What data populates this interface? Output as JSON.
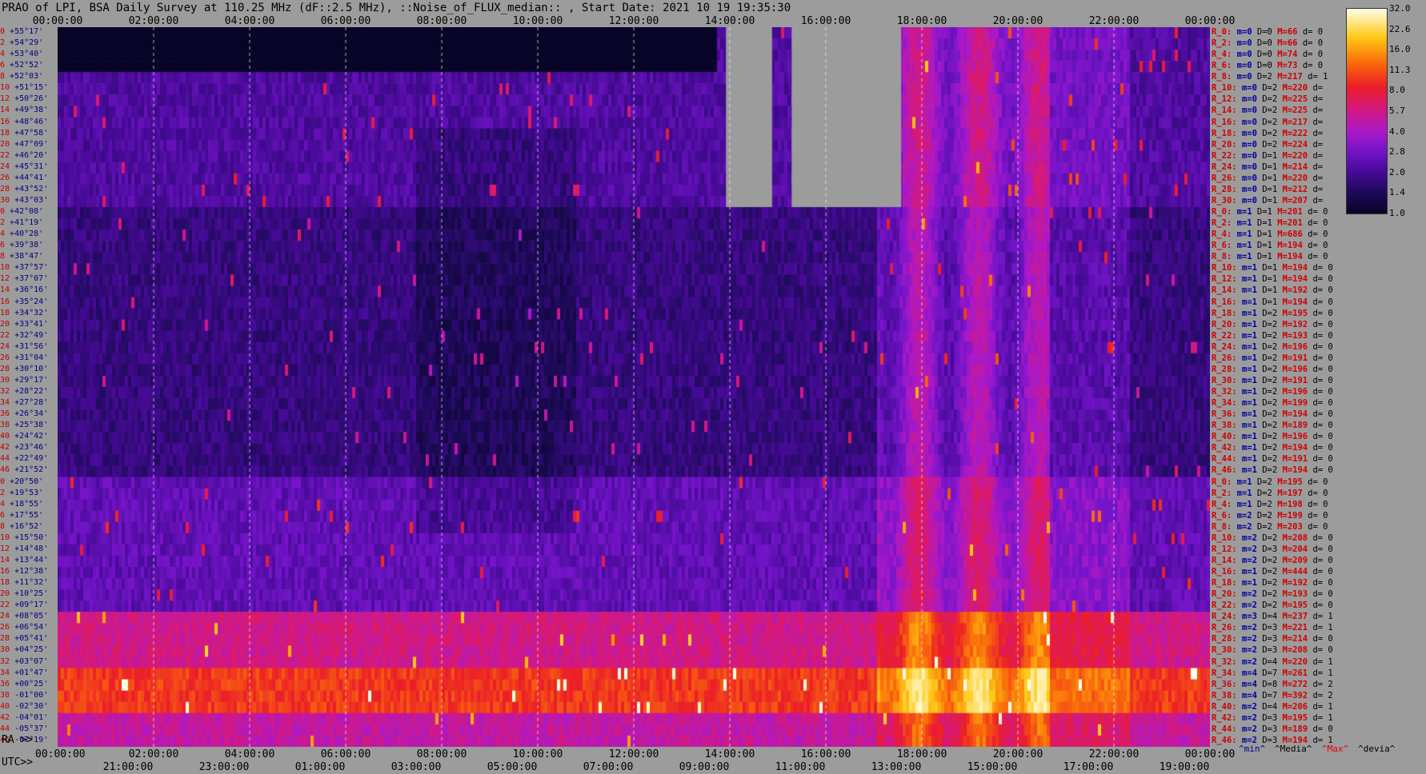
{
  "title": "PRAO of LPI, BSA Daily Survey at 110.25 MHz (dF::2.5 MHz), ::Noise_of_FLUX_median:: , Start Date: 2021 10 19 19:35:30",
  "chart_data": {
    "type": "heatmap",
    "top_axis_ticks": [
      "00:00:00",
      "02:00:00",
      "04:00:00",
      "06:00:00",
      "08:00:00",
      "10:00:00",
      "12:00:00",
      "14:00:00",
      "16:00:00",
      "18:00:00",
      "20:00:00",
      "22:00:00",
      "00:00:00"
    ],
    "ra_label": "RA >>",
    "ra_ticks": [
      "00:00:00",
      "02:00:00",
      "04:00:00",
      "06:00:00",
      "08:00:00",
      "10:00:00",
      "12:00:00",
      "14:00:00",
      "16:00:00",
      "18:00:00",
      "20:00:00",
      "22:00:00",
      "00:00:00"
    ],
    "utc_label": "UTC>>",
    "utc_ticks": [
      "21:00:00",
      "23:00:00",
      "01:00:00",
      "03:00:00",
      "05:00:00",
      "07:00:00",
      "09:00:00",
      "11:00:00",
      "13:00:00",
      "15:00:00",
      "17:00:00",
      "19:00:00"
    ],
    "colorbar_ticks": [
      "32.0",
      "22.6",
      "16.0",
      "11.3",
      "8.0",
      "5.7",
      "4.0",
      "2.8",
      "2.0",
      "1.4",
      "1.0"
    ],
    "colorbar_range": [
      1.0,
      32.0
    ],
    "colorbar_scale": "log",
    "row_indices": [
      "0",
      "2",
      "4",
      "6",
      "8",
      "10",
      "12",
      "14",
      "16",
      "18",
      "20",
      "22",
      "24",
      "26",
      "28",
      "30",
      "0",
      "2",
      "4",
      "6",
      "8",
      "10",
      "12",
      "14",
      "16",
      "18",
      "20",
      "22",
      "24",
      "26",
      "28",
      "30",
      "32",
      "34",
      "36",
      "38",
      "40",
      "42",
      "44",
      "46",
      "0",
      "2",
      "4",
      "6",
      "8",
      "10",
      "12",
      "14",
      "16",
      "18",
      "20",
      "22",
      "24",
      "26",
      "28",
      "30",
      "32",
      "34",
      "36",
      "38",
      "40",
      "42",
      "44",
      "46"
    ],
    "declinations": [
      "+55°17'",
      "+54°29'",
      "+53°40'",
      "+52°52'",
      "+52°03'",
      "+51°15'",
      "+50°26'",
      "+49°38'",
      "+48°46'",
      "+47°58'",
      "+47°09'",
      "+46°20'",
      "+45°31'",
      "+44°41'",
      "+43°52'",
      "+43°03'",
      "+42°08'",
      "+41°19'",
      "+40°28'",
      "+39°38'",
      "+38°47'",
      "+37°57'",
      "+37°07'",
      "+36°16'",
      "+35°24'",
      "+34°32'",
      "+33°41'",
      "+32°49'",
      "+31°56'",
      "+31°04'",
      "+30°10'",
      "+29°17'",
      "+28°22'",
      "+27°28'",
      "+26°34'",
      "+25°38'",
      "+24°42'",
      "+23°46'",
      "+22°49'",
      "+21°52'",
      "+20°50'",
      "+19°53'",
      "+18°55'",
      "+17°55'",
      "+16°52'",
      "+15°50'",
      "+14°48'",
      "+13°44'",
      "+12°38'",
      "+11°32'",
      "+10°25'",
      "+09°17'",
      "+08°05'",
      "+06°54'",
      "+05°41'",
      "+04°25'",
      "+03°07'",
      "+01°47'",
      "+00°25'",
      "-01°00'",
      "-02°30'",
      "-04°01'",
      "-05°37'",
      "-07°19'"
    ],
    "row_stats": [
      {
        "r": "R_0:",
        "m": "m=0",
        "D": "D=0",
        "M": "M=66",
        "d": "d= 0"
      },
      {
        "r": "R_2:",
        "m": "m=0",
        "D": "D=0",
        "M": "M=66",
        "d": "d= 0"
      },
      {
        "r": "R_4:",
        "m": "m=0",
        "D": "D=0",
        "M": "M=74",
        "d": "d= 0"
      },
      {
        "r": "R_6:",
        "m": "m=0",
        "D": "D=0",
        "M": "M=73",
        "d": "d= 0"
      },
      {
        "r": "R_8:",
        "m": "m=0",
        "D": "D=2",
        "M": "M=217",
        "d": "d= 1"
      },
      {
        "r": "R_10:",
        "m": "m=0",
        "D": "D=2",
        "M": "M=220",
        "d": "d="
      },
      {
        "r": "R_12:",
        "m": "m=0",
        "D": "D=2",
        "M": "M=225",
        "d": "d="
      },
      {
        "r": "R_14:",
        "m": "m=0",
        "D": "D=2",
        "M": "M=225",
        "d": "d="
      },
      {
        "r": "R_16:",
        "m": "m=0",
        "D": "D=2",
        "M": "M=217",
        "d": "d="
      },
      {
        "r": "R_18:",
        "m": "m=0",
        "D": "D=2",
        "M": "M=222",
        "d": "d="
      },
      {
        "r": "R_20:",
        "m": "m=0",
        "D": "D=2",
        "M": "M=224",
        "d": "d="
      },
      {
        "r": "R_22:",
        "m": "m=0",
        "D": "D=1",
        "M": "M=220",
        "d": "d="
      },
      {
        "r": "R_24:",
        "m": "m=0",
        "D": "D=1",
        "M": "M=214",
        "d": "d="
      },
      {
        "r": "R_26:",
        "m": "m=0",
        "D": "D=1",
        "M": "M=220",
        "d": "d="
      },
      {
        "r": "R_28:",
        "m": "m=0",
        "D": "D=1",
        "M": "M=212",
        "d": "d="
      },
      {
        "r": "R_30:",
        "m": "m=0",
        "D": "D=1",
        "M": "M=207",
        "d": "d="
      },
      {
        "r": "R_0:",
        "m": "m=1",
        "D": "D=1",
        "M": "M=201",
        "d": "d= 0"
      },
      {
        "r": "R_2:",
        "m": "m=1",
        "D": "D=1",
        "M": "M=201",
        "d": "d= 0"
      },
      {
        "r": "R_4:",
        "m": "m=1",
        "D": "D=1",
        "M": "M=686",
        "d": "d= 0"
      },
      {
        "r": "R_6:",
        "m": "m=1",
        "D": "D=1",
        "M": "M=194",
        "d": "d= 0"
      },
      {
        "r": "R_8:",
        "m": "m=1",
        "D": "D=1",
        "M": "M=194",
        "d": "d= 0"
      },
      {
        "r": "R_10:",
        "m": "m=1",
        "D": "D=1",
        "M": "M=194",
        "d": "d= 0"
      },
      {
        "r": "R_12:",
        "m": "m=1",
        "D": "D=1",
        "M": "M=194",
        "d": "d= 0"
      },
      {
        "r": "R_14:",
        "m": "m=1",
        "D": "D=1",
        "M": "M=192",
        "d": "d= 0"
      },
      {
        "r": "R_16:",
        "m": "m=1",
        "D": "D=1",
        "M": "M=194",
        "d": "d= 0"
      },
      {
        "r": "R_18:",
        "m": "m=1",
        "D": "D=2",
        "M": "M=195",
        "d": "d= 0"
      },
      {
        "r": "R_20:",
        "m": "m=1",
        "D": "D=2",
        "M": "M=192",
        "d": "d= 0"
      },
      {
        "r": "R_22:",
        "m": "m=1",
        "D": "D=2",
        "M": "M=193",
        "d": "d= 0"
      },
      {
        "r": "R_24:",
        "m": "m=1",
        "D": "D=2",
        "M": "M=196",
        "d": "d= 0"
      },
      {
        "r": "R_26:",
        "m": "m=1",
        "D": "D=2",
        "M": "M=191",
        "d": "d= 0"
      },
      {
        "r": "R_28:",
        "m": "m=1",
        "D": "D=2",
        "M": "M=196",
        "d": "d= 0"
      },
      {
        "r": "R_30:",
        "m": "m=1",
        "D": "D=2",
        "M": "M=191",
        "d": "d= 0"
      },
      {
        "r": "R_32:",
        "m": "m=1",
        "D": "D=2",
        "M": "M=196",
        "d": "d= 0"
      },
      {
        "r": "R_34:",
        "m": "m=1",
        "D": "D=2",
        "M": "M=199",
        "d": "d= 0"
      },
      {
        "r": "R_36:",
        "m": "m=1",
        "D": "D=2",
        "M": "M=194",
        "d": "d= 0"
      },
      {
        "r": "R_38:",
        "m": "m=1",
        "D": "D=2",
        "M": "M=189",
        "d": "d= 0"
      },
      {
        "r": "R_40:",
        "m": "m=1",
        "D": "D=2",
        "M": "M=196",
        "d": "d= 0"
      },
      {
        "r": "R_42:",
        "m": "m=1",
        "D": "D=2",
        "M": "M=194",
        "d": "d= 0"
      },
      {
        "r": "R_44:",
        "m": "m=1",
        "D": "D=2",
        "M": "M=191",
        "d": "d= 0"
      },
      {
        "r": "R_46:",
        "m": "m=1",
        "D": "D=2",
        "M": "M=194",
        "d": "d= 0"
      },
      {
        "r": "R_0:",
        "m": "m=1",
        "D": "D=2",
        "M": "M=195",
        "d": "d= 0"
      },
      {
        "r": "R_2:",
        "m": "m=1",
        "D": "D=2",
        "M": "M=197",
        "d": "d= 0"
      },
      {
        "r": "R_4:",
        "m": "m=1",
        "D": "D=2",
        "M": "M=198",
        "d": "d= 0"
      },
      {
        "r": "R_6:",
        "m": "m=2",
        "D": "D=2",
        "M": "M=199",
        "d": "d= 0"
      },
      {
        "r": "R_8:",
        "m": "m=2",
        "D": "D=2",
        "M": "M=203",
        "d": "d= 0"
      },
      {
        "r": "R_10:",
        "m": "m=2",
        "D": "D=2",
        "M": "M=208",
        "d": "d= 0"
      },
      {
        "r": "R_12:",
        "m": "m=2",
        "D": "D=3",
        "M": "M=204",
        "d": "d= 0"
      },
      {
        "r": "R_14:",
        "m": "m=2",
        "D": "D=2",
        "M": "M=209",
        "d": "d= 0"
      },
      {
        "r": "R_16:",
        "m": "m=1",
        "D": "D=2",
        "M": "M=444",
        "d": "d= 0"
      },
      {
        "r": "R_18:",
        "m": "m=1",
        "D": "D=2",
        "M": "M=192",
        "d": "d= 0"
      },
      {
        "r": "R_20:",
        "m": "m=2",
        "D": "D=2",
        "M": "M=193",
        "d": "d= 0"
      },
      {
        "r": "R_22:",
        "m": "m=2",
        "D": "D=2",
        "M": "M=195",
        "d": "d= 0"
      },
      {
        "r": "R_24:",
        "m": "m=3",
        "D": "D=4",
        "M": "M=237",
        "d": "d= 1"
      },
      {
        "r": "R_26:",
        "m": "m=2",
        "D": "D=3",
        "M": "M=221",
        "d": "d= 1"
      },
      {
        "r": "R_28:",
        "m": "m=2",
        "D": "D=3",
        "M": "M=214",
        "d": "d= 0"
      },
      {
        "r": "R_30:",
        "m": "m=2",
        "D": "D=3",
        "M": "M=208",
        "d": "d= 0"
      },
      {
        "r": "R_32:",
        "m": "m=2",
        "D": "D=4",
        "M": "M=220",
        "d": "d= 1"
      },
      {
        "r": "R_34:",
        "m": "m=4",
        "D": "D=7",
        "M": "M=261",
        "d": "d= 1"
      },
      {
        "r": "R_36:",
        "m": "m=4",
        "D": "D=8",
        "M": "M=272",
        "d": "d= 2"
      },
      {
        "r": "R_38:",
        "m": "m=4",
        "D": "D=7",
        "M": "M=392",
        "d": "d= 2"
      },
      {
        "r": "R_40:",
        "m": "m=2",
        "D": "D=4",
        "M": "M=206",
        "d": "d= 1"
      },
      {
        "r": "R_42:",
        "m": "m=2",
        "D": "D=3",
        "M": "M=195",
        "d": "d= 1"
      },
      {
        "r": "R_44:",
        "m": "m=2",
        "D": "D=3",
        "M": "M=189",
        "d": "d= 0"
      },
      {
        "r": "R_46:",
        "m": "m=2",
        "D": "D=3",
        "M": "M=194",
        "d": "d= 1"
      }
    ],
    "legend_keys": [
      {
        "text": "^min^",
        "color": "#00008b"
      },
      {
        "text": "^Media^",
        "color": "#000000"
      },
      {
        "text": "^Max^",
        "color": "#e00000"
      },
      {
        "text": "^devia^",
        "color": "#000000"
      }
    ]
  }
}
